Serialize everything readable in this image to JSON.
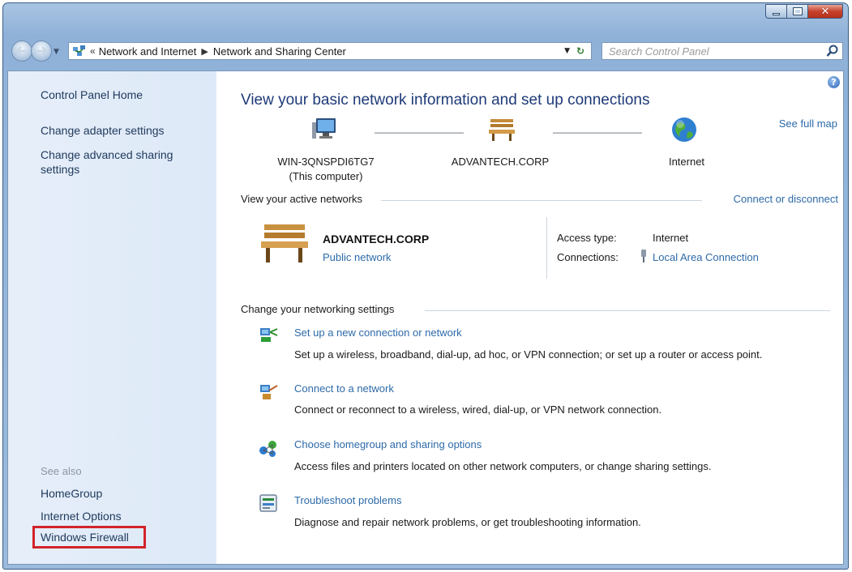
{
  "address_bar": {
    "overflow_glyph": "«",
    "crumbs": [
      "Network and Internet",
      "Network and Sharing Center"
    ]
  },
  "search": {
    "placeholder": "Search Control Panel"
  },
  "sidebar": {
    "links": [
      "Control Panel Home",
      "Change adapter settings",
      "Change advanced sharing settings"
    ],
    "see_also_label": "See also",
    "see_also": [
      "HomeGroup",
      "Internet Options",
      "Windows Firewall"
    ]
  },
  "main": {
    "title": "View your basic network information and set up connections",
    "see_full_map": "See full map",
    "map": {
      "computer_name": "WIN-3QNSPDI6TG7",
      "computer_note": "(This computer)",
      "network": "ADVANTECH.CORP",
      "internet": "Internet"
    },
    "active_networks": {
      "heading": "View your active networks",
      "connect_link": "Connect or disconnect",
      "network_name": "ADVANTECH.CORP",
      "network_type": "Public network",
      "access_type_label": "Access type:",
      "access_type_value": "Internet",
      "connections_label": "Connections:",
      "connections_value": "Local Area Connection"
    },
    "change_settings": {
      "heading": "Change your networking settings",
      "tasks": [
        {
          "title": "Set up a new connection or network",
          "desc": "Set up a wireless, broadband, dial-up, ad hoc, or VPN connection; or set up a router or access point."
        },
        {
          "title": "Connect to a network",
          "desc": "Connect or reconnect to a wireless, wired, dial-up, or VPN network connection."
        },
        {
          "title": "Choose homegroup and sharing options",
          "desc": "Access files and printers located on other network computers, or change sharing settings."
        },
        {
          "title": "Troubleshoot problems",
          "desc": "Diagnose and repair network problems, or get troubleshooting information."
        }
      ]
    }
  },
  "colors": {
    "link": "#2d6aa8",
    "title": "#1e3a78",
    "sidebar_text": "#1e395b",
    "highlight_box": "#d2232a"
  }
}
